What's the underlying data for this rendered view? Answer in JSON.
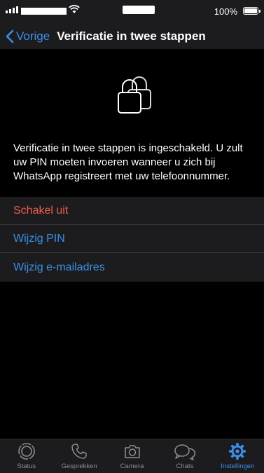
{
  "status_bar": {
    "battery_percent": "100%"
  },
  "nav": {
    "back_label": "Vorige",
    "title": "Verificatie in twee stappen"
  },
  "description": "Verificatie in twee stappen is ingeschakeld. U zult uw PIN moeten invoeren wanneer u zich bij WhatsApp registreert met uw telefoonnummer.",
  "options": {
    "disable": "Schakel uit",
    "change_pin": "Wijzig PIN",
    "change_email": "Wijzig e-mailadres"
  },
  "tabs": [
    {
      "label": "Status",
      "icon": "status-icon"
    },
    {
      "label": "Gesprekken",
      "icon": "phone-icon"
    },
    {
      "label": "Camera",
      "icon": "camera-icon"
    },
    {
      "label": "Chats",
      "icon": "chats-icon"
    },
    {
      "label": "Instellingen",
      "icon": "gear-icon",
      "active": true
    }
  ],
  "colors": {
    "accent": "#3b8fe8",
    "destructive": "#ec5d4b",
    "background": "#000000",
    "surface": "#1c1c1e"
  }
}
